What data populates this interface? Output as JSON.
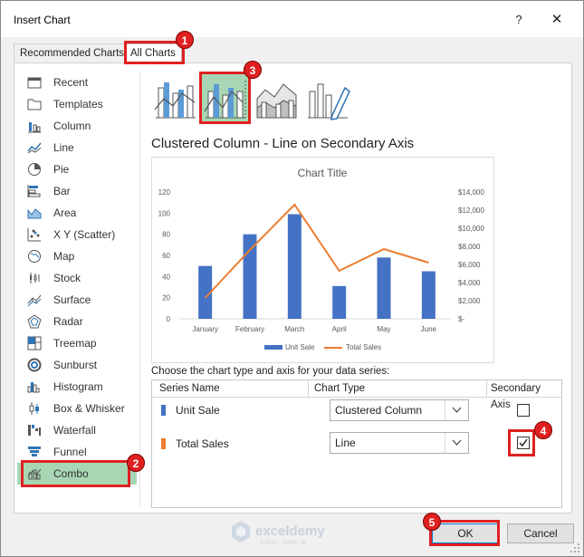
{
  "window": {
    "title": "Insert Chart",
    "help": "?",
    "close": "✕"
  },
  "tabs": [
    {
      "label": "Recommended Charts"
    },
    {
      "label": "All Charts"
    }
  ],
  "sidebar": {
    "items": [
      {
        "label": "Recent",
        "icon": "recent-icon"
      },
      {
        "label": "Templates",
        "icon": "templates-icon"
      },
      {
        "label": "Column",
        "icon": "column-chart-icon"
      },
      {
        "label": "Line",
        "icon": "line-chart-icon"
      },
      {
        "label": "Pie",
        "icon": "pie-chart-icon"
      },
      {
        "label": "Bar",
        "icon": "bar-chart-icon"
      },
      {
        "label": "Area",
        "icon": "area-chart-icon"
      },
      {
        "label": "X Y (Scatter)",
        "icon": "scatter-chart-icon"
      },
      {
        "label": "Map",
        "icon": "map-chart-icon"
      },
      {
        "label": "Stock",
        "icon": "stock-chart-icon"
      },
      {
        "label": "Surface",
        "icon": "surface-chart-icon"
      },
      {
        "label": "Radar",
        "icon": "radar-chart-icon"
      },
      {
        "label": "Treemap",
        "icon": "treemap-chart-icon"
      },
      {
        "label": "Sunburst",
        "icon": "sunburst-chart-icon"
      },
      {
        "label": "Histogram",
        "icon": "histogram-chart-icon"
      },
      {
        "label": "Box & Whisker",
        "icon": "box-whisker-chart-icon"
      },
      {
        "label": "Waterfall",
        "icon": "waterfall-chart-icon"
      },
      {
        "label": "Funnel",
        "icon": "funnel-chart-icon"
      },
      {
        "label": "Combo",
        "icon": "combo-chart-icon",
        "selected": true
      }
    ]
  },
  "subtypes": [
    {
      "name": "clustered-column-line",
      "selected": false
    },
    {
      "name": "clustered-column-line-secondary-axis",
      "selected": true
    },
    {
      "name": "stacked-area-clustered-column",
      "selected": false
    },
    {
      "name": "custom-combination",
      "selected": false
    }
  ],
  "subtype_heading": "Clustered Column - Line on Secondary Axis",
  "chart_data": {
    "type": "bar",
    "title": "Chart Title",
    "categories": [
      "January",
      "February",
      "March",
      "April",
      "May",
      "June"
    ],
    "series": [
      {
        "name": "Unit Sale",
        "type": "bar",
        "axis": "primary",
        "color": "#4472c4",
        "values": [
          50,
          80,
          99,
          31,
          58,
          45
        ]
      },
      {
        "name": "Total Sales",
        "type": "line",
        "axis": "secondary",
        "color": "#ed7d31",
        "values": [
          2300,
          7600,
          12600,
          5300,
          7700,
          6200
        ]
      }
    ],
    "y_ticks": [
      "120",
      "100",
      "80",
      "60",
      "40",
      "20",
      "0"
    ],
    "y2_ticks": [
      "$14,000",
      "$12,000",
      "$10,000",
      "$8,000",
      "$6,000",
      "$4,000",
      "$2,000",
      "$-"
    ],
    "ylim": [
      0,
      120
    ],
    "y2lim": [
      0,
      14000
    ],
    "legend": "bottom",
    "grid": false
  },
  "series_section": {
    "label": "Choose the chart type and axis for your data series:",
    "headers": {
      "name": "Series Name",
      "type": "Chart Type",
      "axis": "Secondary Axis"
    },
    "rows": [
      {
        "name": "Unit Sale",
        "color": "#4472c4",
        "chart_type": "Clustered Column",
        "secondary": false
      },
      {
        "name": "Total Sales",
        "color": "#ed7d31",
        "chart_type": "Line",
        "secondary": true
      }
    ]
  },
  "buttons": {
    "ok": "OK",
    "cancel": "Cancel"
  },
  "annotations": [
    "1",
    "2",
    "3",
    "4",
    "5"
  ],
  "watermark": {
    "brand": "exceldemy",
    "tagline": "EXCEL · DATA · BI"
  },
  "colors": {
    "accent_red": "#e02020",
    "selected_green": "#a8d6b4",
    "bar_blue": "#4472c4",
    "line_orange": "#ed7d31"
  }
}
